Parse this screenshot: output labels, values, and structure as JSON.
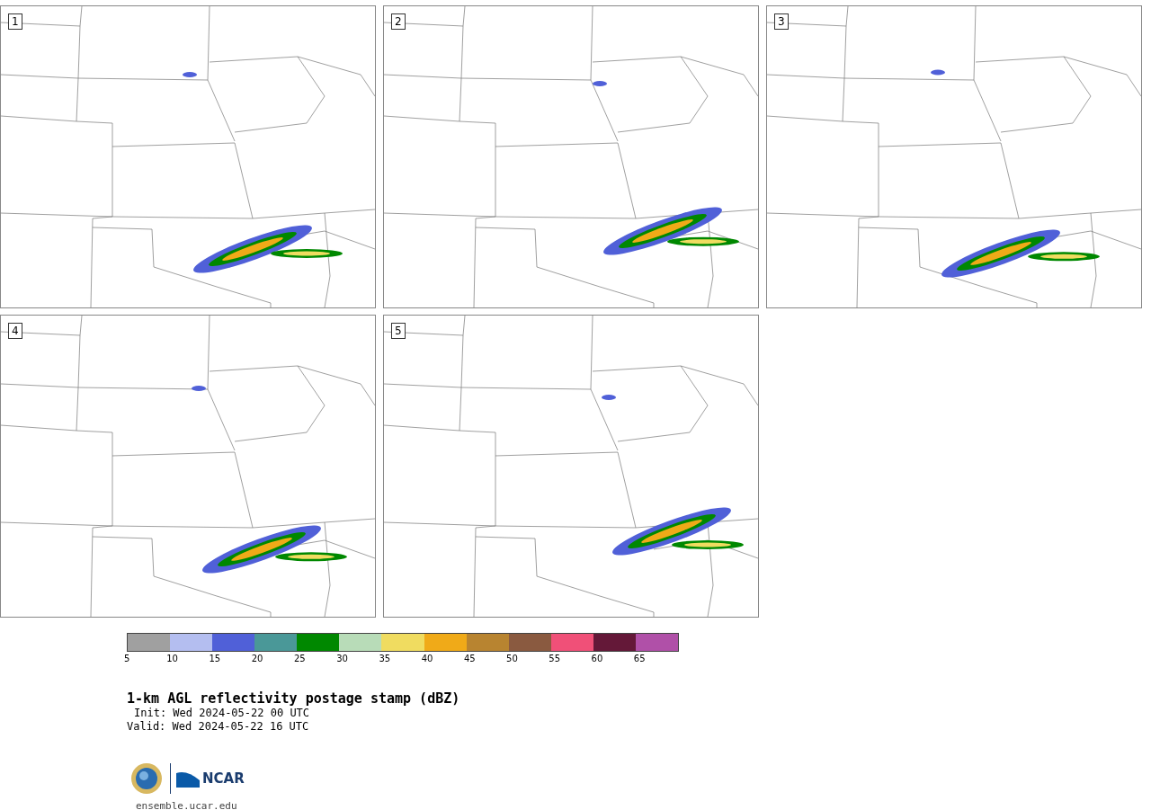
{
  "panels": [
    {
      "label": "1"
    },
    {
      "label": "2"
    },
    {
      "label": "3"
    },
    {
      "label": "4"
    },
    {
      "label": "5"
    }
  ],
  "colorbar": {
    "bins": [
      {
        "color": "#a0a0a0"
      },
      {
        "color": "#b4bef0"
      },
      {
        "color": "#5060d8"
      },
      {
        "color": "#4a9898"
      },
      {
        "color": "#008800"
      },
      {
        "color": "#b8dcb8"
      },
      {
        "color": "#f0dc60"
      },
      {
        "color": "#f0aa18"
      },
      {
        "color": "#b88430"
      },
      {
        "color": "#8a5a40"
      },
      {
        "color": "#f05078"
      },
      {
        "color": "#641838"
      },
      {
        "color": "#b050a8"
      }
    ],
    "ticks": [
      "5",
      "10",
      "15",
      "20",
      "25",
      "30",
      "35",
      "40",
      "45",
      "50",
      "55",
      "60",
      "65"
    ]
  },
  "title": "1-km AGL reflectivity postage stamp (dBZ)",
  "init": "Init: Wed 2024-05-22 00 UTC",
  "valid": "Valid: Wed 2024-05-22 16 UTC",
  "logo": {
    "ncar": "NCAR"
  },
  "url": "ensemble.ucar.edu"
}
